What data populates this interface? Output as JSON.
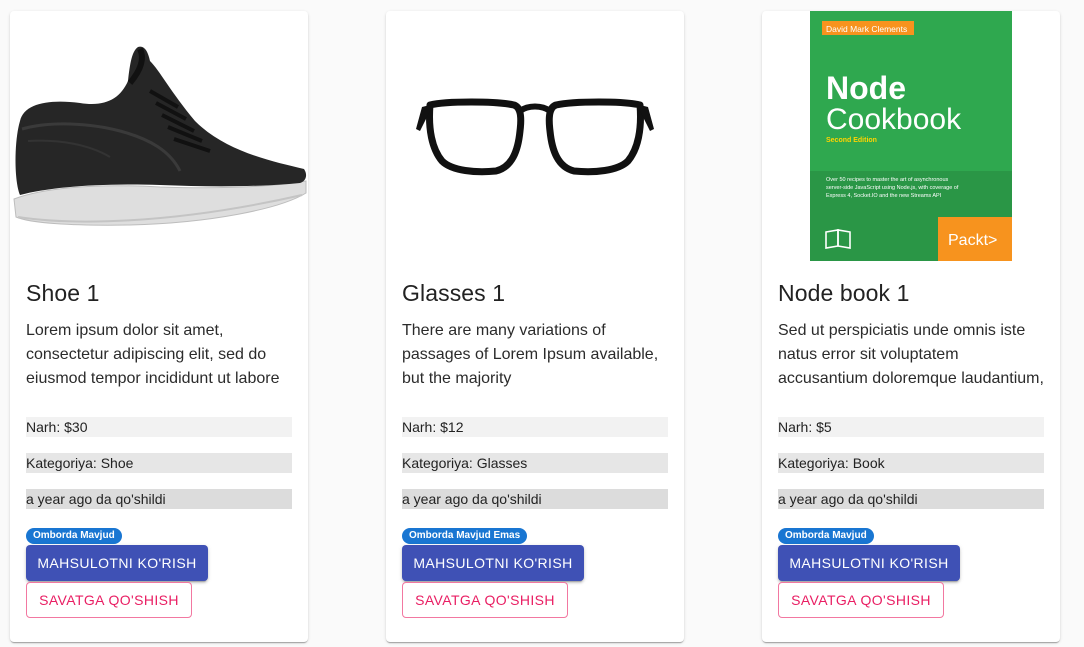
{
  "products": [
    {
      "title": "Shoe 1",
      "description": "Lorem ipsum dolor sit amet, consectetur adipiscing elit, sed do eiusmod tempor incididunt ut labore",
      "price": "Narh: $30",
      "category": "Kategoriya: Shoe",
      "date": "a year ago da qo'shildi",
      "stock": "Omborda Mavjud",
      "view_label": "MAHSULOTNI KO'RISH",
      "cart_label": "SAVATGA QO'SHISH"
    },
    {
      "title": "Glasses 1",
      "description": "There are many variations of passages of Lorem Ipsum available, but the majority",
      "price": "Narh: $12",
      "category": "Kategoriya: Glasses",
      "date": "a year ago da qo'shildi",
      "stock": "Omborda Mavjud Emas",
      "view_label": "MAHSULOTNI KO'RISH",
      "cart_label": "SAVATGA QO'SHISH"
    },
    {
      "title": "Node book 1",
      "description": "Sed ut perspiciatis unde omnis iste natus error sit voluptatem accusantium doloremque laudantium,",
      "price": "Narh: $5",
      "category": "Kategoriya: Book",
      "date": "a year ago da qo'shildi",
      "stock": "Omborda Mavjud",
      "view_label": "MAHSULOTNI KO'RISH",
      "cart_label": "SAVATGA QO'SHISH"
    }
  ],
  "book_cover": {
    "author": "David Mark Clements",
    "title_line1": "Node",
    "title_line2": "Cookbook",
    "edition": "Second Edition",
    "blurb_line1": "Over 50 recipes to master the art of asynchronous",
    "blurb_line2": "server-side JavaScript using Node.js, with coverage of",
    "blurb_line3": "Express 4, Socket.IO and the new Streams API",
    "publisher": "Packt>"
  },
  "colors": {
    "primary_button": "#3f51b5",
    "secondary_button": "#e91e63",
    "badge": "#1976d2",
    "book_green": "#2fa84f",
    "book_orange": "#f7931e"
  }
}
